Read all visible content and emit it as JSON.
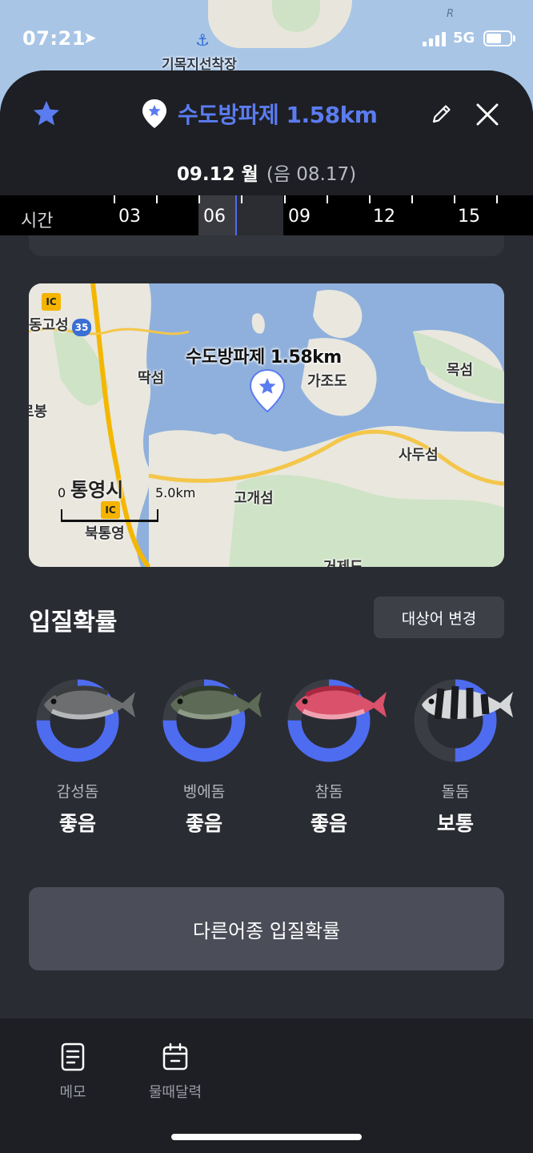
{
  "status_bar": {
    "time": "07:21",
    "network": "5G"
  },
  "background_map": {
    "harbor_label": "기목지선착장",
    "road_mark": "R"
  },
  "header": {
    "title": "수도방파제 1.58km",
    "date": "09.12 월",
    "lunar": "(음 08.17)"
  },
  "timeline": {
    "label": "시간",
    "hours": [
      "03",
      "06",
      "09",
      "12",
      "15"
    ],
    "selected_hour": "06"
  },
  "map": {
    "pin_label": "수도방파제 1.58km",
    "places": [
      "동고성",
      "딱섬",
      "가조도",
      "목섬",
      "사두섬",
      "고개섬",
      "통영시",
      "북통영",
      "거제도",
      "로봉"
    ],
    "ic_label": "IC",
    "highway": "35",
    "scale": {
      "min": "0",
      "max": "5.0km"
    }
  },
  "catch_probability": {
    "title": "입질확률",
    "change_button": "대상어 변경",
    "fish": [
      {
        "name": "감성돔",
        "rating": "좋음",
        "probability": 0.75
      },
      {
        "name": "벵에돔",
        "rating": "좋음",
        "probability": 0.75
      },
      {
        "name": "참돔",
        "rating": "좋음",
        "probability": 0.75
      },
      {
        "name": "돌돔",
        "rating": "보통",
        "probability": 0.5
      }
    ],
    "other_button": "다른어종 입질확률"
  },
  "colors": {
    "accent": "#4d6cf0",
    "ring_track": "#3b3d45",
    "background": "#2a2c33"
  },
  "tabbar": [
    {
      "label": "메모",
      "icon": "memo-icon"
    },
    {
      "label": "물때달력",
      "icon": "calendar-icon"
    }
  ]
}
